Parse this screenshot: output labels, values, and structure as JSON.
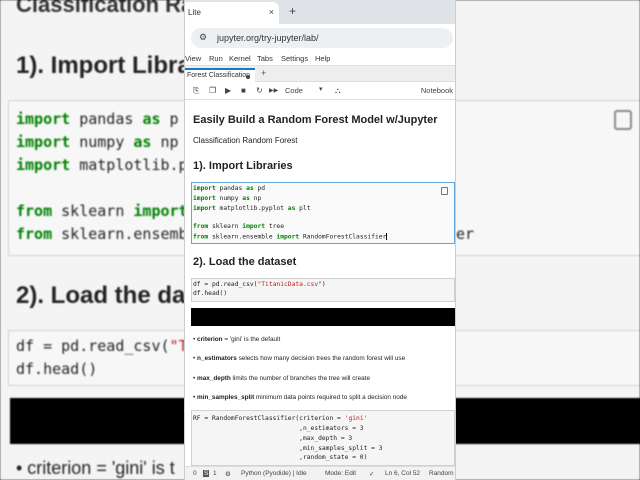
{
  "background": {
    "title": "Classification Rand",
    "heading1": "1). Import Libra",
    "code_lines": [
      {
        "kw": "import",
        "rest": " pandas ",
        "kw2": "as",
        "rest2": " p"
      },
      {
        "kw": "import",
        "rest": " numpy ",
        "kw2": "as",
        "rest2": " np"
      },
      {
        "kw": "import",
        "rest": " matplotlib.p",
        "kw2": "",
        "rest2": ""
      },
      {
        "kw": "from",
        "rest": " sklearn ",
        "kw2": "import",
        "rest2": ""
      },
      {
        "kw": "from",
        "rest": " sklearn.ensemb",
        "kw2": "",
        "rest2": ""
      }
    ],
    "code_tail": "er",
    "heading2": "2). Load the da",
    "df_line_a": "df = pd.read_csv(",
    "df_line_str": "\"T",
    "df_line_b": "df.head()",
    "bullet": "• criterion = 'gini' is t"
  },
  "browser": {
    "tab_label": "Lite",
    "tab_close": "×",
    "new_tab": "+",
    "site_icon": "⚙",
    "url": "jupyter.org/try-jupyter/lab/"
  },
  "menu": [
    "View",
    "Run",
    "Kernel",
    "Tabs",
    "Settings",
    "Help"
  ],
  "notebook_tab": {
    "label": "Forest Classification",
    "new": "+"
  },
  "toolbar": {
    "icons": [
      "⎘",
      "❐",
      "▶",
      "■",
      "↻",
      "▶▶"
    ],
    "cell_type": "Code",
    "chevron": "▾",
    "bug_icon": "⛬",
    "kernel": "Notebook"
  },
  "cells": {
    "title": "Easily Build a Random Forest Model w/Jupyter",
    "subtitle": "Classification Random Forest",
    "h_import": "1). Import Libraries",
    "import_lines": [
      {
        "a": "import",
        "b": " pandas ",
        "c": "as",
        "d": " pd"
      },
      {
        "a": "import",
        "b": " numpy ",
        "c": "as",
        "d": " np"
      },
      {
        "a": "import",
        "b": " matplotlib.pyplot ",
        "c": "as",
        "d": " plt"
      },
      {
        "a": "",
        "b": "",
        "c": "",
        "d": ""
      },
      {
        "a": "from",
        "b": " sklearn ",
        "c": "import",
        "d": " tree"
      },
      {
        "a": "from",
        "b": " sklearn.ensemble ",
        "c": "import",
        "d": " RandomForestClassifier"
      }
    ],
    "h_load": "2). Load the dataset",
    "load_line1_a": "df = pd.read_csv(",
    "load_line1_str": "\"TitanicData.csv\"",
    "load_line1_b": ")",
    "load_line2": "df.head()",
    "bullets": [
      {
        "bold": "criterion",
        "text": " = 'gini' is the default"
      },
      {
        "bold": "n_estimators",
        "text": " selects how many decision trees the random forest will use"
      },
      {
        "bold": "max_depth",
        "text": " limits the number of branches the tree will create"
      },
      {
        "bold": "min_samples_split",
        "text": " minimum data points required to split a decision node"
      }
    ],
    "rf_lines": [
      {
        "pre": "RF = RandomForestClassifier(criterion = ",
        "str": "'gini'"
      },
      {
        "pre": "                            ,n_estimators = 3",
        "str": ""
      },
      {
        "pre": "                            ,max_depth = 3",
        "str": ""
      },
      {
        "pre": "                            ,min_samples_split = 3",
        "str": ""
      },
      {
        "pre": "                            ,random_state = 0)",
        "str": ""
      }
    ]
  },
  "status": {
    "count": "0",
    "s_badge": "S",
    "count2": "1",
    "gear": "⚙",
    "kernel": "Python (Pyodide) | Idle",
    "mode": "Mode: Edit",
    "check": "✓",
    "position": "Ln 6, Col 52",
    "file": "Random"
  }
}
